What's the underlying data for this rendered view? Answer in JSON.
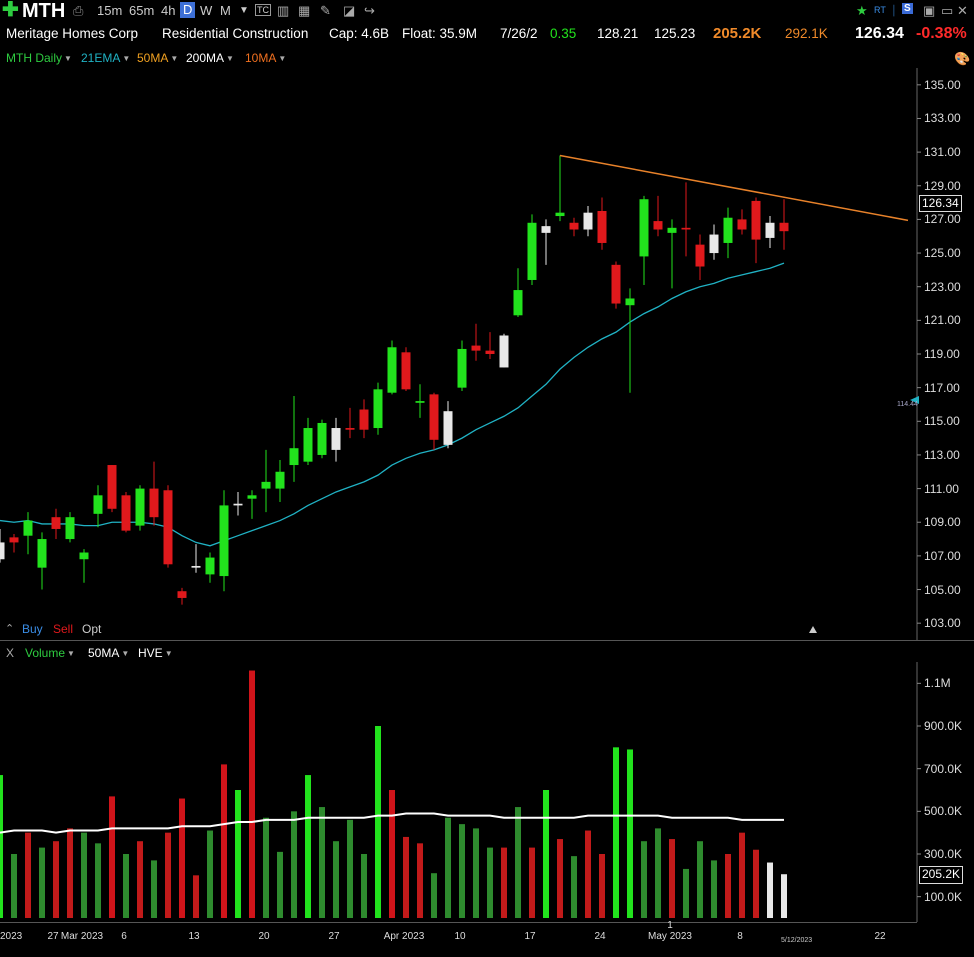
{
  "toolbar": {
    "symbol": "MTH",
    "timeframes": [
      "15m",
      "65m",
      "4h",
      "D",
      "W",
      "M"
    ],
    "active_timeframe": "D",
    "tc_label": "TC",
    "rt_label": "RT",
    "s_label": "S"
  },
  "info": {
    "company": "Meritage Homes Corp",
    "industry": "Residential Construction",
    "cap": "Cap: 4.6B",
    "float": "Float: 35.9M",
    "date": "7/26/2",
    "change": "0.35",
    "high": "128.21",
    "low": "125.23",
    "volume": "205.2K",
    "avg_volume": "292.1K",
    "last": "126.34",
    "pct_change": "-0.38%"
  },
  "studies": {
    "chart_label": "MTH Daily",
    "ema21": "21EMA",
    "ma50": "50MA",
    "ma200": "200MA",
    "ma10": "10MA"
  },
  "order": {
    "buy": "Buy",
    "sell": "Sell",
    "opt": "Opt"
  },
  "volume_pane": {
    "close": "X",
    "label": "Volume",
    "ma": "50MA",
    "hve": "HVE",
    "last_box": "205.2K"
  },
  "price_box": "126.34",
  "marker_label": "114.44",
  "date_marker": "5/12/2023",
  "colors": {
    "up": "#22e31d",
    "down": "#e0191c",
    "neutral": "#e8e8e8",
    "ema": "#20b2c4",
    "trend": "#e8822a",
    "vol_up": "#2e8b2e",
    "vol_down": "#c21a1a"
  },
  "chart_data": [
    {
      "type": "candlestick",
      "title": "MTH Daily",
      "ylim": [
        102,
        136
      ],
      "yticks": [
        "135.00",
        "133.00",
        "131.00",
        "129.00",
        "127.00",
        "125.00",
        "123.00",
        "121.00",
        "119.00",
        "117.00",
        "115.00",
        "113.00",
        "111.00",
        "109.00",
        "107.00",
        "105.00",
        "103.00"
      ],
      "xticks": [
        "2023",
        "27",
        "Mar 2023",
        "6",
        "13",
        "20",
        "27",
        "Apr 2023",
        "10",
        "17",
        "24",
        "1",
        "May 2023",
        "8",
        "22"
      ],
      "series": [
        {
          "name": "price",
          "candles": [
            {
              "o": 107.8,
              "h": 108.6,
              "l": 106.6,
              "c": 106.8,
              "u": "n"
            },
            {
              "o": 107.8,
              "h": 108.3,
              "l": 107.2,
              "c": 108.1,
              "u": "d"
            },
            {
              "o": 108.2,
              "h": 109.6,
              "l": 107.1,
              "c": 109.1,
              "u": "u"
            },
            {
              "o": 108.0,
              "h": 108.4,
              "l": 105.0,
              "c": 106.3,
              "u": "u"
            },
            {
              "o": 109.3,
              "h": 109.8,
              "l": 108.0,
              "c": 108.6,
              "u": "d"
            },
            {
              "o": 108.0,
              "h": 109.6,
              "l": 107.8,
              "c": 109.3,
              "u": "u"
            },
            {
              "o": 107.2,
              "h": 107.4,
              "l": 105.4,
              "c": 106.8,
              "u": "u"
            },
            {
              "o": 109.5,
              "h": 111.2,
              "l": 108.7,
              "c": 110.6,
              "u": "u"
            },
            {
              "o": 112.4,
              "h": 112.4,
              "l": 109.6,
              "c": 109.8,
              "u": "d"
            },
            {
              "o": 110.6,
              "h": 110.8,
              "l": 108.4,
              "c": 108.5,
              "u": "d"
            },
            {
              "o": 108.8,
              "h": 111.2,
              "l": 108.5,
              "c": 111.0,
              "u": "u"
            },
            {
              "o": 111.0,
              "h": 112.6,
              "l": 108.8,
              "c": 109.3,
              "u": "d"
            },
            {
              "o": 110.9,
              "h": 111.2,
              "l": 106.3,
              "c": 106.5,
              "u": "d"
            },
            {
              "o": 104.9,
              "h": 105.1,
              "l": 104.1,
              "c": 104.5,
              "u": "d"
            },
            {
              "o": 106.3,
              "h": 107.7,
              "l": 106.0,
              "c": 106.4,
              "u": "n"
            },
            {
              "o": 106.9,
              "h": 107.2,
              "l": 105.4,
              "c": 105.9,
              "u": "u"
            },
            {
              "o": 105.8,
              "h": 110.9,
              "l": 104.9,
              "c": 110.0,
              "u": "u"
            },
            {
              "o": 110.0,
              "h": 110.8,
              "l": 109.4,
              "c": 110.1,
              "u": "n"
            },
            {
              "o": 110.4,
              "h": 110.9,
              "l": 109.2,
              "c": 110.6,
              "u": "u"
            },
            {
              "o": 111.0,
              "h": 113.3,
              "l": 109.6,
              "c": 111.4,
              "u": "u"
            },
            {
              "o": 111.0,
              "h": 112.7,
              "l": 110.2,
              "c": 112.0,
              "u": "u"
            },
            {
              "o": 112.4,
              "h": 116.5,
              "l": 111.4,
              "c": 113.4,
              "u": "u"
            },
            {
              "o": 112.6,
              "h": 115.2,
              "l": 112.4,
              "c": 114.6,
              "u": "u"
            },
            {
              "o": 113.0,
              "h": 115.1,
              "l": 112.8,
              "c": 114.9,
              "u": "u"
            },
            {
              "o": 113.3,
              "h": 115.2,
              "l": 112.6,
              "c": 114.6,
              "u": "n"
            },
            {
              "o": 114.6,
              "h": 115.8,
              "l": 114.0,
              "c": 114.5,
              "u": "d"
            },
            {
              "o": 115.7,
              "h": 116.3,
              "l": 114.0,
              "c": 114.5,
              "u": "d"
            },
            {
              "o": 114.6,
              "h": 117.3,
              "l": 114.2,
              "c": 116.9,
              "u": "u"
            },
            {
              "o": 116.7,
              "h": 119.8,
              "l": 116.6,
              "c": 119.4,
              "u": "u"
            },
            {
              "o": 119.1,
              "h": 119.4,
              "l": 116.8,
              "c": 116.9,
              "u": "d"
            },
            {
              "o": 116.2,
              "h": 117.2,
              "l": 115.2,
              "c": 116.1,
              "u": "u"
            },
            {
              "o": 116.6,
              "h": 116.7,
              "l": 113.3,
              "c": 113.9,
              "u": "d"
            },
            {
              "o": 113.6,
              "h": 116.2,
              "l": 113.4,
              "c": 115.6,
              "u": "n"
            },
            {
              "o": 117.0,
              "h": 119.8,
              "l": 116.8,
              "c": 119.3,
              "u": "u"
            },
            {
              "o": 119.5,
              "h": 120.8,
              "l": 118.6,
              "c": 119.2,
              "u": "d"
            },
            {
              "o": 119.2,
              "h": 120.3,
              "l": 118.7,
              "c": 119.0,
              "u": "d"
            },
            {
              "o": 118.2,
              "h": 120.2,
              "l": 118.2,
              "c": 120.1,
              "u": "n"
            },
            {
              "o": 121.3,
              "h": 124.1,
              "l": 121.2,
              "c": 122.8,
              "u": "u"
            },
            {
              "o": 123.4,
              "h": 127.3,
              "l": 123.1,
              "c": 126.8,
              "u": "u"
            },
            {
              "o": 126.2,
              "h": 127.0,
              "l": 124.3,
              "c": 126.6,
              "u": "n"
            },
            {
              "o": 127.2,
              "h": 130.8,
              "l": 126.9,
              "c": 127.4,
              "u": "u"
            },
            {
              "o": 126.4,
              "h": 127.1,
              "l": 126.0,
              "c": 126.8,
              "u": "d"
            },
            {
              "o": 126.4,
              "h": 127.8,
              "l": 126.0,
              "c": 127.4,
              "u": "n"
            },
            {
              "o": 127.5,
              "h": 128.3,
              "l": 125.2,
              "c": 125.6,
              "u": "d"
            },
            {
              "o": 124.3,
              "h": 124.5,
              "l": 121.7,
              "c": 122.0,
              "u": "d"
            },
            {
              "o": 121.9,
              "h": 122.9,
              "l": 116.7,
              "c": 122.3,
              "u": "u"
            },
            {
              "o": 124.8,
              "h": 128.4,
              "l": 123.1,
              "c": 128.2,
              "u": "u"
            },
            {
              "o": 126.9,
              "h": 128.4,
              "l": 126.0,
              "c": 126.4,
              "u": "d"
            },
            {
              "o": 126.2,
              "h": 127.0,
              "l": 122.9,
              "c": 126.5,
              "u": "u"
            },
            {
              "o": 126.5,
              "h": 129.2,
              "l": 124.8,
              "c": 126.4,
              "u": "d"
            },
            {
              "o": 125.5,
              "h": 126.1,
              "l": 123.4,
              "c": 124.2,
              "u": "d"
            },
            {
              "o": 125.0,
              "h": 126.7,
              "l": 124.6,
              "c": 126.1,
              "u": "n"
            },
            {
              "o": 125.6,
              "h": 127.7,
              "l": 124.7,
              "c": 127.1,
              "u": "u"
            },
            {
              "o": 127.0,
              "h": 127.6,
              "l": 126.1,
              "c": 126.4,
              "u": "d"
            },
            {
              "o": 128.1,
              "h": 128.3,
              "l": 124.4,
              "c": 125.8,
              "u": "d"
            },
            {
              "o": 125.9,
              "h": 127.2,
              "l": 125.3,
              "c": 126.8,
              "u": "n"
            },
            {
              "o": 126.8,
              "h": 128.2,
              "l": 125.2,
              "c": 126.3,
              "u": "d"
            }
          ]
        },
        {
          "name": "21EMA",
          "values": [
            109.1,
            109.0,
            109.1,
            108.9,
            108.9,
            108.9,
            108.8,
            108.8,
            109.0,
            109.0,
            109.0,
            108.9,
            108.7,
            108.2,
            107.8,
            107.6,
            107.9,
            108.2,
            108.5,
            108.8,
            109.1,
            109.5,
            110.0,
            110.4,
            110.8,
            111.1,
            111.4,
            111.8,
            112.4,
            112.8,
            113.1,
            113.3,
            113.6,
            114.0,
            114.5,
            114.9,
            115.3,
            115.8,
            116.5,
            117.2,
            118.1,
            118.8,
            119.4,
            119.9,
            120.3,
            120.9,
            121.4,
            121.8,
            122.3,
            122.7,
            123.0,
            123.2,
            123.5,
            123.7,
            123.9,
            124.1,
            124.4
          ]
        },
        {
          "name": "trendline",
          "from": [
            40,
            130.8
          ],
          "to": [
            64.5,
            127.0
          ]
        }
      ]
    },
    {
      "type": "bar",
      "title": "Volume",
      "ylim": [
        0,
        1200000
      ],
      "yticks": [
        "1.1M",
        "900.0K",
        "700.0K",
        "500.0K",
        "300.0K",
        "100.0K"
      ],
      "values": [
        670000,
        300000,
        400000,
        330000,
        360000,
        420000,
        400000,
        350000,
        570000,
        300000,
        360000,
        270000,
        400000,
        560000,
        200000,
        410000,
        720000,
        600000,
        1160000,
        470000,
        310000,
        500000,
        670000,
        520000,
        360000,
        460000,
        300000,
        900000,
        600000,
        380000,
        350000,
        210000,
        470000,
        440000,
        420000,
        330000,
        330000,
        520000,
        330000,
        600000,
        370000,
        290000,
        410000,
        300000,
        800000,
        790000,
        360000,
        420000,
        370000,
        230000,
        360000,
        270000,
        300000,
        400000,
        320000,
        260000,
        205200
      ],
      "colors": [
        "u",
        "u",
        "d",
        "u",
        "d",
        "d",
        "u",
        "u",
        "d",
        "u",
        "d",
        "u",
        "d",
        "d",
        "d",
        "u",
        "d",
        "u",
        "d",
        "u",
        "u",
        "u",
        "u",
        "u",
        "u",
        "u",
        "u",
        "u",
        "d",
        "d",
        "d",
        "u",
        "u",
        "u",
        "u",
        "u",
        "d",
        "u",
        "d",
        "u",
        "d",
        "u",
        "d",
        "d",
        "u",
        "u",
        "u",
        "u",
        "d",
        "u",
        "u",
        "u",
        "d",
        "d",
        "d",
        "n",
        "n"
      ],
      "ma50": [
        400000,
        410000,
        410000,
        410000,
        400000,
        410000,
        410000,
        410000,
        420000,
        420000,
        420000,
        420000,
        420000,
        430000,
        430000,
        430000,
        440000,
        450000,
        450000,
        460000,
        460000,
        460000,
        470000,
        470000,
        470000,
        470000,
        470000,
        480000,
        480000,
        490000,
        490000,
        490000,
        480000,
        480000,
        480000,
        480000,
        470000,
        470000,
        470000,
        470000,
        470000,
        470000,
        480000,
        480000,
        480000,
        480000,
        480000,
        480000,
        470000,
        470000,
        470000,
        470000,
        470000,
        460000,
        460000,
        460000,
        460000
      ]
    }
  ]
}
